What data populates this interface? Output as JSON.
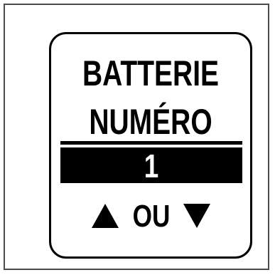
{
  "display": {
    "title_line1": "BATTERIE",
    "title_line2": "NUMÉRO",
    "value": "1",
    "nav_separator": "OU",
    "up_icon": "up-triangle",
    "down_icon": "down-triangle"
  },
  "colors": {
    "background": "#ffffff",
    "foreground": "#000000",
    "frame_border": "#4a4a4a"
  }
}
